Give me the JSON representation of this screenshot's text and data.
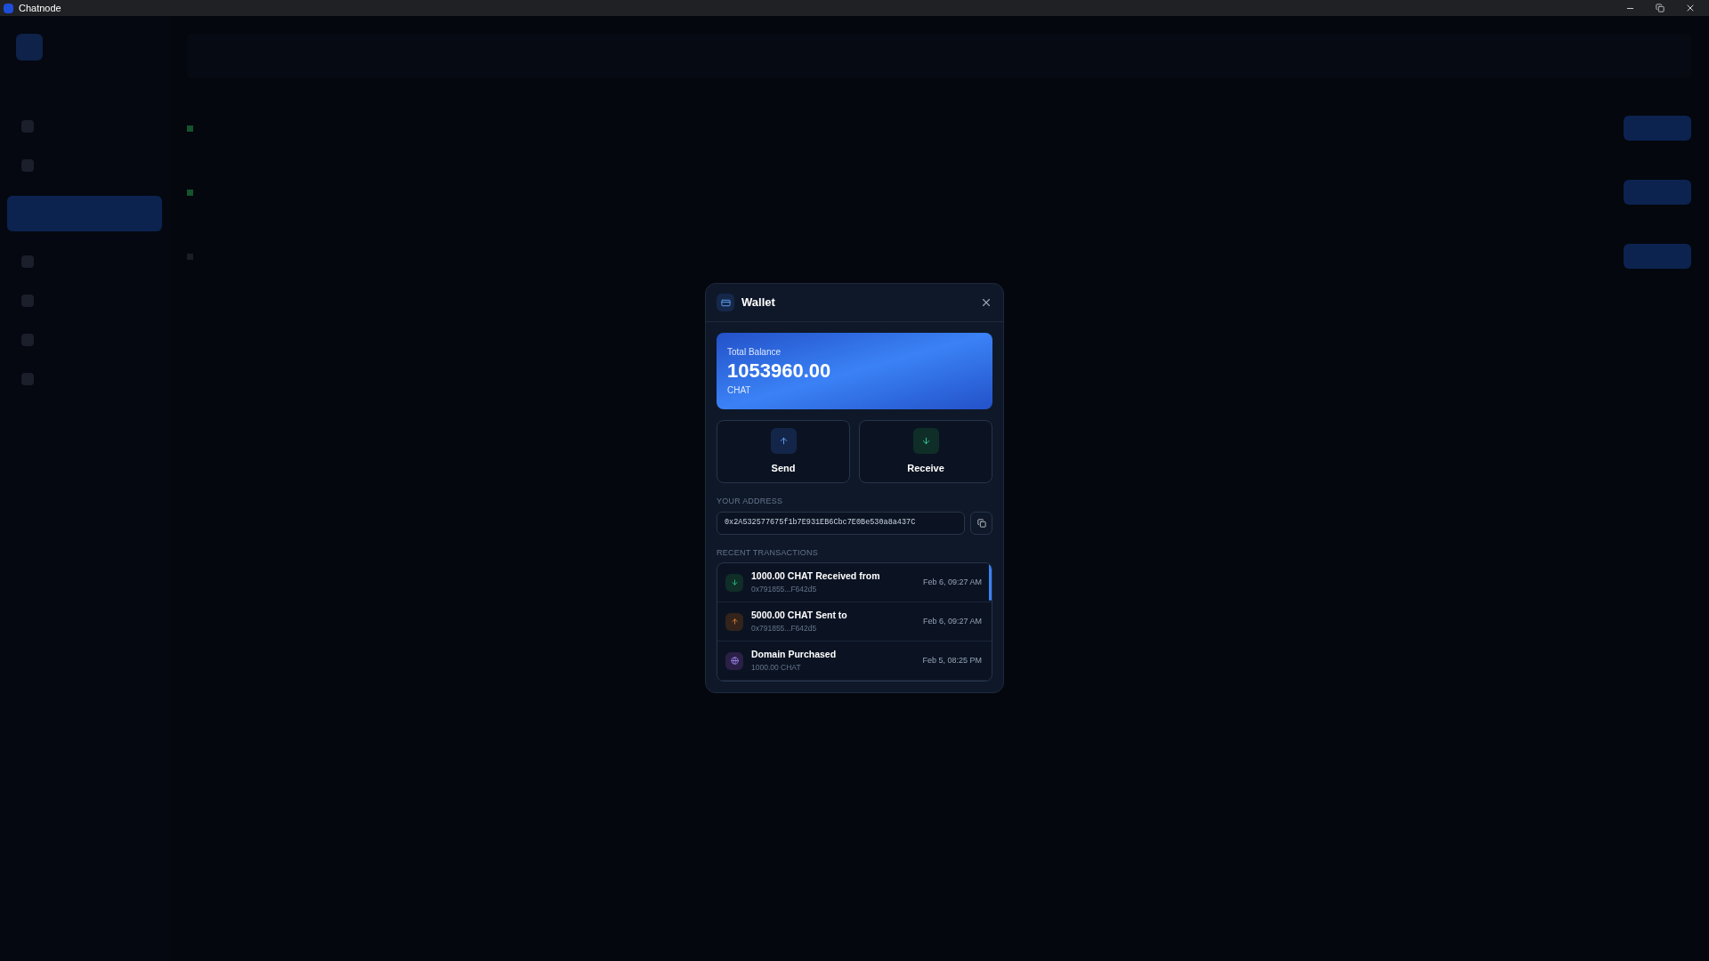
{
  "window": {
    "title": "Chatnode"
  },
  "wallet": {
    "title": "Wallet",
    "balance_label": "Total Balance",
    "balance": "1053960.00",
    "currency": "CHAT",
    "actions": [
      {
        "kind": "send",
        "label": "Send"
      },
      {
        "kind": "receive",
        "label": "Receive"
      }
    ],
    "address_label": "YOUR ADDRESS",
    "address": "0x2A532577675f1b7E931EB6Cbc7E0Be530a8a437C",
    "transactions_label": "RECENT TRANSACTIONS",
    "transactions": [
      {
        "kind": "receive",
        "title": "1000.00 CHAT Received from",
        "detail": "0x791855...F642d5",
        "time": "Feb 6, 09:27 AM"
      },
      {
        "kind": "send",
        "title": "5000.00 CHAT Sent to",
        "detail": "0x791855...F642d5",
        "time": "Feb 6, 09:27 AM"
      },
      {
        "kind": "domain",
        "title": "Domain Purchased",
        "detail": "1000.00 CHAT",
        "time": "Feb 5, 08:25 PM"
      }
    ]
  }
}
